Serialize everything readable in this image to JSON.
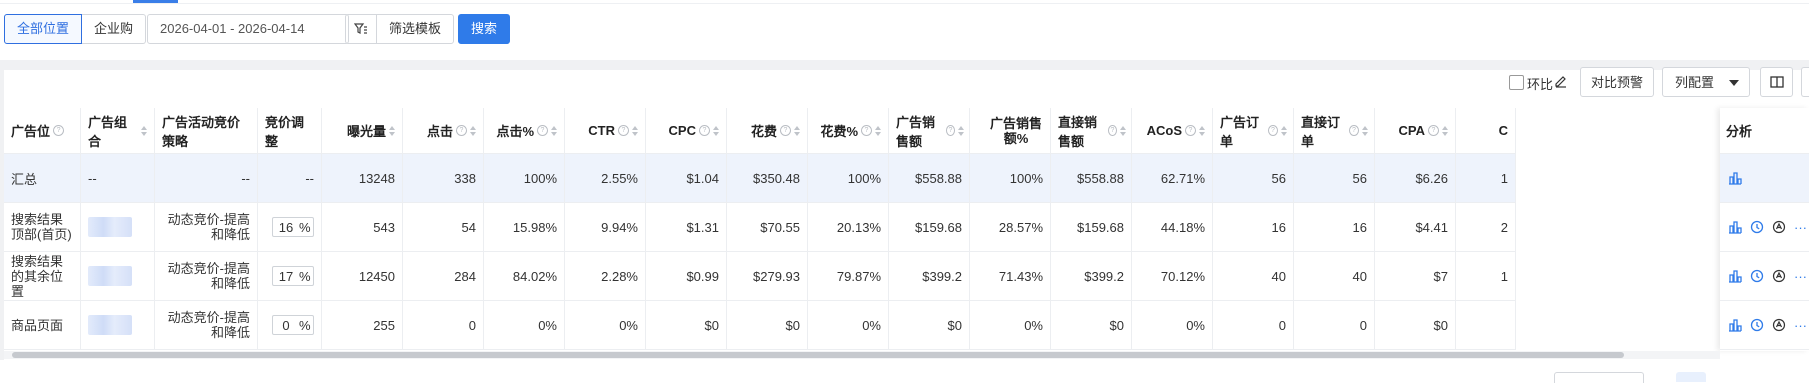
{
  "filters": {
    "scope_all": "全部位置",
    "scope_business": "企业购",
    "date_range": "2026-04-01 - 2026-04-14",
    "filter_template": "筛选模板",
    "search": "搜索"
  },
  "toolbar": {
    "hb_label": "环比",
    "compare_alert": "对比预警",
    "column_config": "列配置"
  },
  "table": {
    "headers": {
      "placement": "广告位",
      "ad_group": "广告组合",
      "bid_strategy": "广告活动竞价策略",
      "bid_adjust": "竞价调整",
      "impressions": "曝光量",
      "clicks": "点击",
      "click_pct": "点击%",
      "ctr": "CTR",
      "cpc": "CPC",
      "spend": "花费",
      "spend_pct": "花费%",
      "ad_sales": "广告销售额",
      "ad_sales_pct": "广告销售额%",
      "direct_sales": "直接销售额",
      "acos": "ACoS",
      "ad_orders": "广告订单",
      "direct_orders": "直接订单",
      "cpa": "CPA",
      "cut": "C",
      "analysis": "分析"
    },
    "summary": {
      "placement": "汇总",
      "ad_group": "--",
      "bid_strategy": "--",
      "bid_adjust": "--",
      "impressions": "13248",
      "clicks": "338",
      "click_pct": "100%",
      "ctr": "2.55%",
      "cpc": "$1.04",
      "spend": "$350.48",
      "spend_pct": "100%",
      "ad_sales": "$558.88",
      "ad_sales_pct": "100%",
      "direct_sales": "$558.88",
      "acos": "62.71%",
      "ad_orders": "56",
      "direct_orders": "56",
      "cpa": "$6.26",
      "cut": "1"
    },
    "rows": [
      {
        "placement": "搜索结果顶部(首页)",
        "bid_strategy": "动态竞价-提高和降低",
        "bid_value": "16",
        "bid_unit": "%",
        "impressions": "543",
        "clicks": "54",
        "click_pct": "15.98%",
        "ctr": "9.94%",
        "cpc": "$1.31",
        "spend": "$70.55",
        "spend_pct": "20.13%",
        "ad_sales": "$159.68",
        "ad_sales_pct": "28.57%",
        "direct_sales": "$159.68",
        "acos": "44.18%",
        "ad_orders": "16",
        "direct_orders": "16",
        "cpa": "$4.41",
        "cut": "2"
      },
      {
        "placement": "搜索结果的其余位置",
        "bid_strategy": "动态竞价-提高和降低",
        "bid_value": "17",
        "bid_unit": "%",
        "impressions": "12450",
        "clicks": "284",
        "click_pct": "84.02%",
        "ctr": "2.28%",
        "cpc": "$0.99",
        "spend": "$279.93",
        "spend_pct": "79.87%",
        "ad_sales": "$399.2",
        "ad_sales_pct": "71.43%",
        "direct_sales": "$399.2",
        "acos": "70.12%",
        "ad_orders": "40",
        "direct_orders": "40",
        "cpa": "$7",
        "cut": "1"
      },
      {
        "placement": "商品页面",
        "bid_strategy": "动态竞价-提高和降低",
        "bid_value": "0",
        "bid_unit": "%",
        "impressions": "255",
        "clicks": "0",
        "click_pct": "0%",
        "ctr": "0%",
        "cpc": "$0",
        "spend": "$0",
        "spend_pct": "0%",
        "ad_sales": "$0",
        "ad_sales_pct": "0%",
        "direct_sales": "$0",
        "acos": "0%",
        "ad_orders": "0",
        "direct_orders": "0",
        "cpa": "$0",
        "cut": ""
      }
    ]
  },
  "icons": {
    "analysis": [
      "bar-chart-icon",
      "clock-icon",
      "history-icon",
      "more-icon"
    ]
  },
  "colors": {
    "primary": "#2f7be9",
    "summary_bg": "#eef3fc"
  }
}
